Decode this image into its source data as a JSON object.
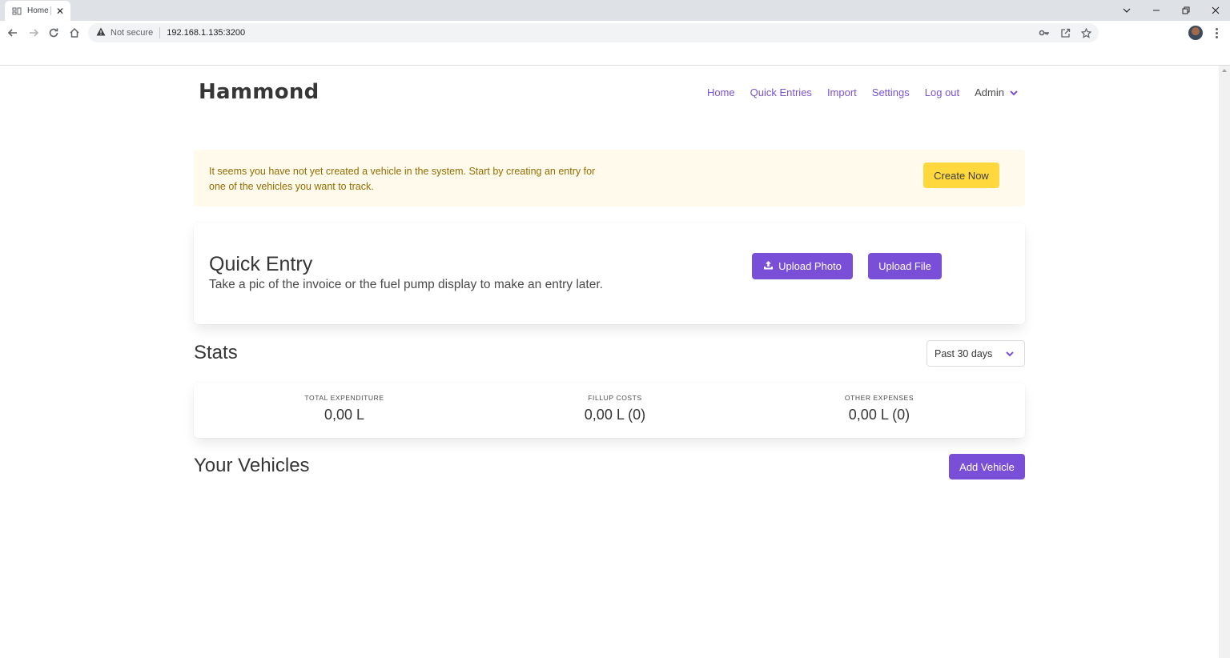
{
  "browser": {
    "tab_title": "Home",
    "security_label": "Not secure",
    "url": "192.168.1.135:3200"
  },
  "app": {
    "brand": "Hammond",
    "nav": {
      "home": "Home",
      "quick_entries": "Quick Entries",
      "import": "Import",
      "settings": "Settings",
      "logout": "Log out",
      "user": "Admin"
    }
  },
  "notice": {
    "text": "It seems you have not yet created a vehicle in the system. Start by creating an entry for one of the vehicles you want to track.",
    "button": "Create Now"
  },
  "quick_entry": {
    "title": "Quick Entry",
    "subtitle": "Take a pic of the invoice or the fuel pump display to make an entry later.",
    "upload_photo": "Upload Photo",
    "upload_file": "Upload File"
  },
  "stats": {
    "title": "Stats",
    "period": "Past 30 days",
    "items": [
      {
        "label": "TOTAL EXPENDITURE",
        "value": "0,00 L"
      },
      {
        "label": "FILLUP COSTS",
        "value": "0,00 L (0)"
      },
      {
        "label": "OTHER EXPENSES",
        "value": "0,00 L (0)"
      }
    ]
  },
  "vehicles": {
    "title": "Your Vehicles",
    "add_button": "Add Vehicle"
  },
  "colors": {
    "accent": "#7a4fd8",
    "warning_bg": "#fffaeb",
    "warning_text": "#946c00",
    "warning_button": "#ffd83d"
  },
  "icons": {
    "tab_favicon": "app-favicon-icon",
    "tab_close": "close-icon",
    "back": "arrow-left-icon",
    "forward": "arrow-right-icon",
    "reload": "reload-icon",
    "home": "home-icon",
    "warning": "warning-triangle-icon",
    "key": "key-icon",
    "share": "share-icon",
    "star": "star-icon",
    "upload": "upload-icon",
    "chevron": "chevron-down-icon"
  }
}
